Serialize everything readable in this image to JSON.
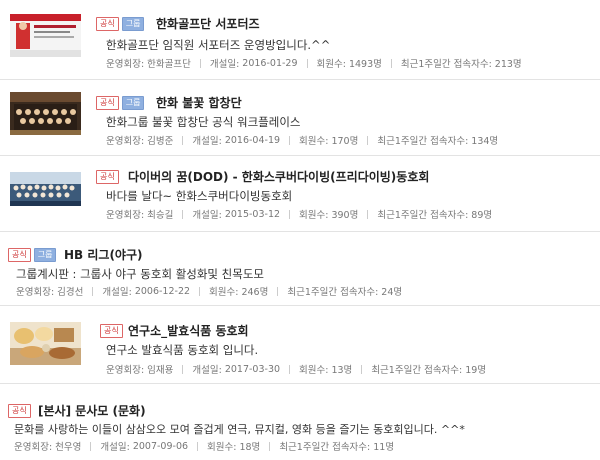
{
  "badges": {
    "official": "공식",
    "group": "그룹"
  },
  "meta_labels": {
    "admin": "운영회장:",
    "opened": "개설일:",
    "members": "회원수:",
    "recent": "최근1주일간 접속자수:"
  },
  "clubs": [
    {
      "title": "한화골프단 서포터즈",
      "desc": "한화골프단 임직원 서포터즈 운영방입니다.^^",
      "admin": "한화골프단",
      "opened": "2016-01-29",
      "members": "1493명",
      "recent": "213명",
      "has_group_badge": true,
      "thumb": "golf-supporters-photo"
    },
    {
      "title": "한화 불꽃 합창단",
      "desc": "한화그룹 불꽃 합창단 공식 워크플레이스",
      "admin": "김병준",
      "opened": "2016-04-19",
      "members": "170명",
      "recent": "134명",
      "has_group_badge": true,
      "thumb": "choir-photo"
    },
    {
      "title": "다이버의 꿈(DOD) - 한화스쿠버다이빙(프리다이빙)동호회",
      "desc": "바다를 날다~ 한화스쿠버다이빙동호회",
      "admin": "최승길",
      "opened": "2015-03-12",
      "members": "390명",
      "recent": "89명",
      "has_group_badge": false,
      "thumb": "diving-group-photo"
    },
    {
      "title": "HB 리그(야구)",
      "desc": "그룹계시판 : 그룹사 야구 동호회 활성화및 친목도모",
      "admin": "김경선",
      "opened": "2006-12-22",
      "members": "246명",
      "recent": "24명",
      "has_group_badge": true,
      "thumb": null
    },
    {
      "title": "연구소_발효식품 동호회",
      "desc": "연구소 발효식품 동호회 입니다.",
      "admin": "임재용",
      "opened": "2017-03-30",
      "members": "13명",
      "recent": "19명",
      "has_group_badge": false,
      "thumb": "fermented-food-photo"
    },
    {
      "title": "[본사] 문사모 (문화)",
      "desc": "문화를 사랑하는 이들이 삼삼오오 모여 즐겁게 연극, 뮤지컬, 영화 등을 즐기는 동호회입니다. ^^*",
      "admin": "천우영",
      "opened": "2007-09-06",
      "members": "18명",
      "recent": "11명",
      "has_group_badge": false,
      "thumb": null
    }
  ]
}
